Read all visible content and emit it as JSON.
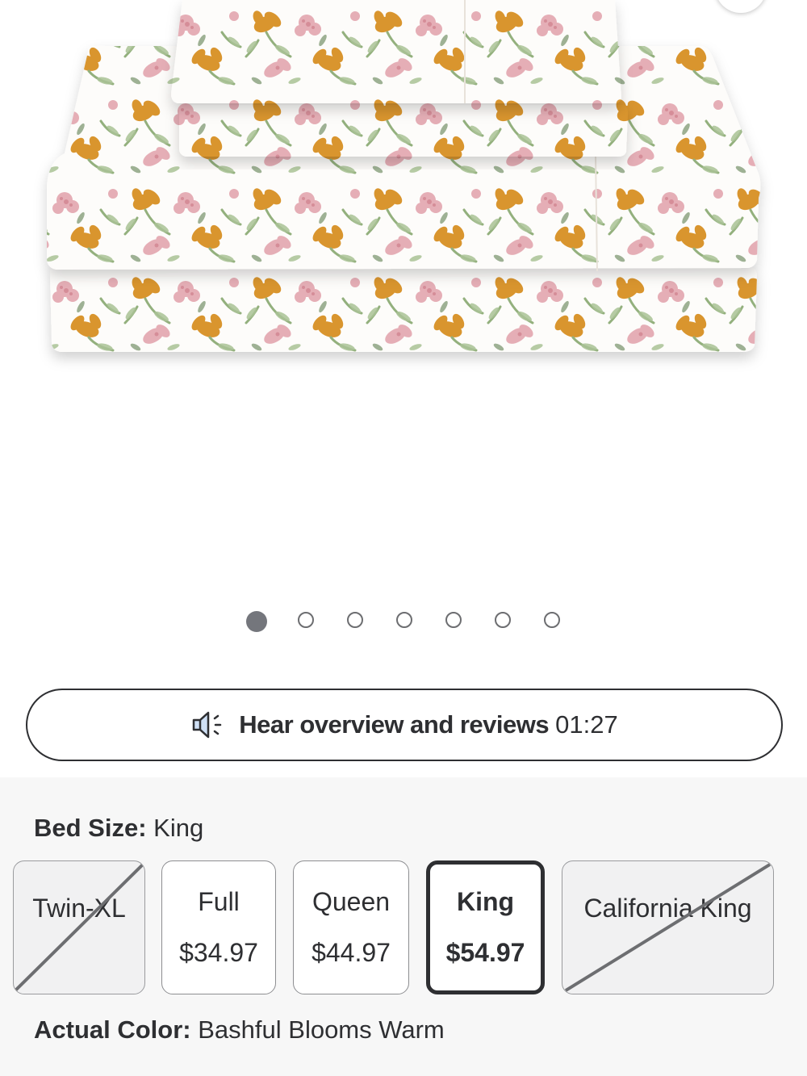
{
  "product": {
    "image_alt": "Floral sheet set",
    "carousel": {
      "total": 7,
      "active_index": 0
    }
  },
  "audio_overview": {
    "label": "Hear overview and reviews",
    "duration": "01:27"
  },
  "bed_size": {
    "label": "Bed Size:",
    "selected": "King",
    "options": [
      {
        "name": "Twin-XL",
        "price": "",
        "available": false,
        "selected": false
      },
      {
        "name": "Full",
        "price": "$34.97",
        "available": true,
        "selected": false
      },
      {
        "name": "Queen",
        "price": "$44.97",
        "available": true,
        "selected": false
      },
      {
        "name": "King",
        "price": "$54.97",
        "available": true,
        "selected": true
      },
      {
        "name": "California King",
        "price": "",
        "available": false,
        "selected": false
      }
    ]
  },
  "color": {
    "label": "Actual Color:",
    "selected": "Bashful Blooms Warm"
  },
  "colors": {
    "text": "#2e2f32",
    "panel_bg": "#f7f7f7",
    "dot_active": "#74767c",
    "flower_orange": "#d9952e",
    "flower_pink": "#e3a5ae",
    "leaf_green": "#93b07d"
  }
}
